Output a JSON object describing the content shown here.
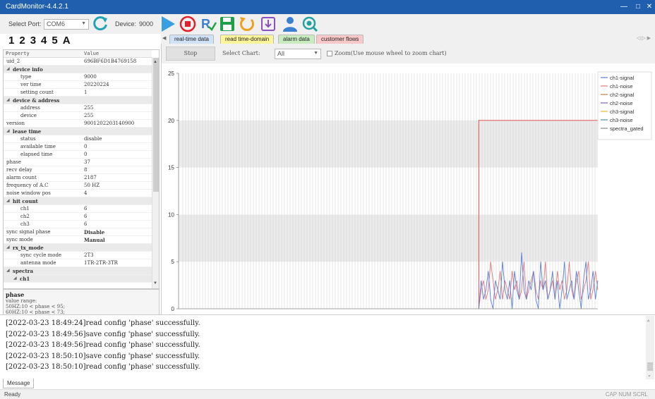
{
  "app": {
    "title": "CardMonitor-4.4.2.1"
  },
  "toolbar": {
    "port_label": "Select Port:",
    "port_value": "COM6",
    "device_label": "Device:",
    "device_value": "9000"
  },
  "number_tabs": [
    "1",
    "2",
    "3",
    "4",
    "5",
    "A"
  ],
  "property_grid": {
    "headers": {
      "property": "Property",
      "value": "Value"
    },
    "rows": [
      {
        "key": "uid_2",
        "value": "696BF6D1B4769158",
        "level": 0,
        "cat": false
      },
      {
        "key": "device info",
        "value": "",
        "level": 0,
        "cat": true
      },
      {
        "key": "type",
        "value": "9000",
        "level": 1,
        "cat": false
      },
      {
        "key": "ver time",
        "value": "20220224",
        "level": 1,
        "cat": false
      },
      {
        "key": "setting count",
        "value": "1",
        "level": 1,
        "cat": false
      },
      {
        "key": "device & address",
        "value": "",
        "level": 0,
        "cat": true
      },
      {
        "key": "address",
        "value": "255",
        "level": 1,
        "cat": false
      },
      {
        "key": "device",
        "value": "255",
        "level": 1,
        "cat": false
      },
      {
        "key": "version",
        "value": "9001202203140900",
        "level": 0,
        "cat": false
      },
      {
        "key": "lease time",
        "value": "",
        "level": 0,
        "cat": true
      },
      {
        "key": "status",
        "value": "disable",
        "level": 1,
        "cat": false
      },
      {
        "key": "available time",
        "value": "0",
        "level": 1,
        "cat": false
      },
      {
        "key": "elapsed time",
        "value": "0",
        "level": 1,
        "cat": false
      },
      {
        "key": "phase",
        "value": "37",
        "level": 0,
        "cat": false
      },
      {
        "key": "recv delay",
        "value": "8",
        "level": 0,
        "cat": false
      },
      {
        "key": "alarm count",
        "value": "2187",
        "level": 0,
        "cat": false
      },
      {
        "key": "frequency of A.C",
        "value": "50 HZ",
        "level": 0,
        "cat": false
      },
      {
        "key": "noise window pos",
        "value": "4",
        "level": 0,
        "cat": false
      },
      {
        "key": "hit count",
        "value": "",
        "level": 0,
        "cat": true
      },
      {
        "key": "ch1",
        "value": "6",
        "level": 1,
        "cat": false
      },
      {
        "key": "ch2",
        "value": "6",
        "level": 1,
        "cat": false
      },
      {
        "key": "ch3",
        "value": "6",
        "level": 1,
        "cat": false
      },
      {
        "key": "sync signal phase",
        "value": "Disable",
        "level": 0,
        "cat": false,
        "bold": true
      },
      {
        "key": "sync mode",
        "value": "Manual",
        "level": 0,
        "cat": false,
        "bold": true
      },
      {
        "key": "rx_tx_mode",
        "value": "",
        "level": 0,
        "cat": true
      },
      {
        "key": "sync cycle mode",
        "value": "2T3",
        "level": 1,
        "cat": false
      },
      {
        "key": "antenna mode",
        "value": "1TR-2TR-3TR",
        "level": 1,
        "cat": false
      },
      {
        "key": "spectra",
        "value": "",
        "level": 0,
        "cat": true
      },
      {
        "key": "ch1",
        "value": "",
        "level": 1,
        "cat": true
      }
    ]
  },
  "description": {
    "title": "phase",
    "line1": "value range:",
    "line2": "50HZ:10 < phase < 95;",
    "line3": "60HZ:10 < phase < 73;"
  },
  "tabs": [
    {
      "label": "real-time data",
      "color": "#cfe2f7"
    },
    {
      "label": "read time-domain",
      "color": "#fff59a"
    },
    {
      "label": "alarm data",
      "color": "#c8ecc0"
    },
    {
      "label": "customer flows",
      "color": "#f9c8c8"
    }
  ],
  "chart_controls": {
    "stop_label": "Stop",
    "select_chart_label": "Select Chart:",
    "select_value": "All",
    "zoom_label": "Zoom(Use mouse wheel to zoom chart)"
  },
  "chart_data": {
    "type": "line",
    "ylim": [
      0,
      25
    ],
    "yticks": [
      0,
      5,
      10,
      15,
      20,
      25
    ],
    "series_names": [
      "ch1-signal",
      "ch1-noise",
      "ch2-signal",
      "ch2-noise",
      "ch3-signal",
      "ch3-noise",
      "spectra_gated"
    ],
    "series_colors": [
      "#5b7fd6",
      "#e07a7a",
      "#c77a3a",
      "#7a5cb0",
      "#e3b341",
      "#4e8fa8",
      "#888888"
    ],
    "gated_step": {
      "x_frac": 0.716,
      "value": 20
    },
    "ch1_signal": [
      0,
      3,
      1,
      2,
      4,
      1,
      0,
      3,
      2,
      1,
      5,
      2,
      1,
      3,
      0,
      4,
      2,
      1,
      6,
      2,
      1,
      3,
      2,
      4,
      1,
      0,
      5,
      2,
      3,
      1,
      2,
      4,
      1,
      3,
      0,
      2,
      5,
      1,
      2,
      3,
      1,
      4,
      2,
      0,
      3,
      5,
      1,
      2,
      4,
      1,
      3
    ],
    "ch1_noise": [
      0,
      2,
      3,
      1,
      2,
      5,
      3,
      1,
      2,
      4,
      1,
      3,
      2,
      1,
      4,
      2,
      3,
      1,
      2,
      5,
      1,
      2,
      3,
      4,
      2,
      1,
      3,
      2,
      5,
      1,
      2,
      3,
      1,
      4,
      2,
      3,
      1,
      2,
      5,
      2,
      1,
      3,
      4,
      1,
      2,
      3,
      5,
      1,
      2,
      4,
      2
    ]
  },
  "messages": [
    "[2022-03-23 18:49:24]read config 'phase' successfully.",
    "[2022-03-23 18:49:56]save config 'phase' successfully.",
    "[2022-03-23 18:49:56]read config 'phase' successfully.",
    "[2022-03-23 18:50:10]save config 'phase' successfully.",
    "[2022-03-23 18:50:10]read config 'phase' successfully."
  ],
  "message_tab": "Message",
  "status": {
    "ready": "Ready",
    "indicators": "CAP NUM SCRL"
  }
}
